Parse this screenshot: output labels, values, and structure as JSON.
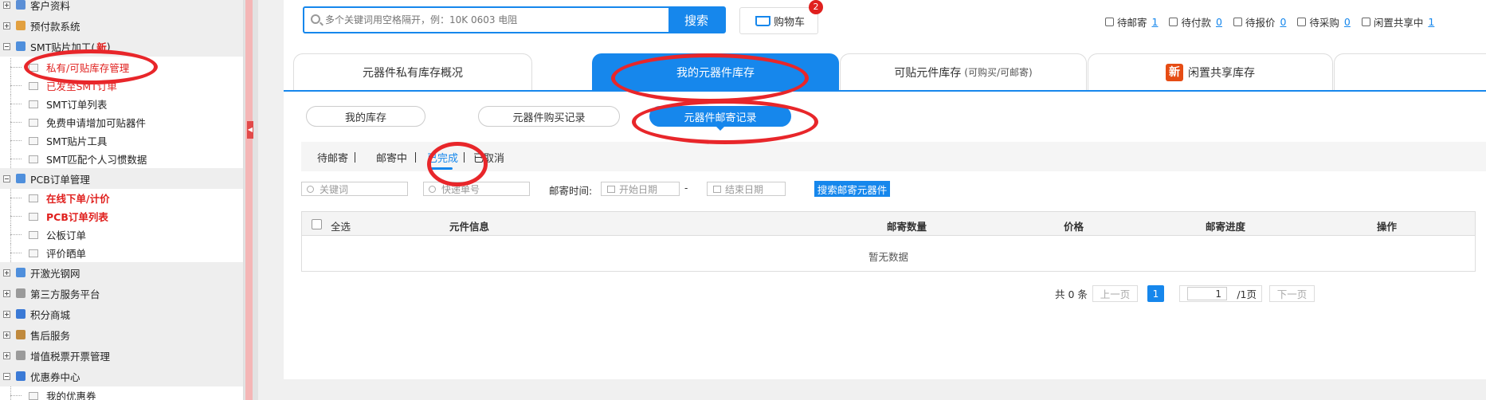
{
  "sidebar": {
    "rows": [
      {
        "kind": "group",
        "label": "客户资料",
        "expander": "plus",
        "icon_color": "#5b8fd6",
        "icon": "user-icon"
      },
      {
        "kind": "group",
        "label": "预付款系统",
        "expander": "plus",
        "icon_color": "#e2a03f",
        "icon": "wallet-icon"
      },
      {
        "kind": "group",
        "label": "SMT贴片加工(",
        "tag": "新",
        "tag_end": ")",
        "expander": "minus",
        "icon_color": "#4f8fdc",
        "icon": "chip-icon"
      },
      {
        "kind": "item",
        "label": "私有/可贴库存管理",
        "style": "red2"
      },
      {
        "kind": "item",
        "label": "已发至SMT订单",
        "style": "red2"
      },
      {
        "kind": "item",
        "label": "SMT订单列表"
      },
      {
        "kind": "item",
        "label": "免费申请增加可贴器件"
      },
      {
        "kind": "item",
        "label": "SMT贴片工具"
      },
      {
        "kind": "item",
        "label": "SMT匹配个人习惯数据"
      },
      {
        "kind": "group",
        "label": "PCB订单管理",
        "expander": "minus",
        "icon_color": "#4f8fdc",
        "icon": "board-icon"
      },
      {
        "kind": "item",
        "label": "在线下单/计价",
        "style": "red"
      },
      {
        "kind": "item",
        "label": "PCB订单列表",
        "style": "red"
      },
      {
        "kind": "item",
        "label": "公板订单"
      },
      {
        "kind": "item",
        "label": "评价晒单"
      },
      {
        "kind": "group",
        "label": "开激光钢网",
        "expander": "plus",
        "icon_color": "#4f8fdc",
        "icon": "laser-icon"
      },
      {
        "kind": "group",
        "label": "第三方服务平台",
        "expander": "plus",
        "icon_color": "#9a9a9a",
        "icon": "service-icon"
      },
      {
        "kind": "group",
        "label": "积分商城",
        "expander": "plus",
        "icon_color": "#3b7ad6",
        "icon": "coin-icon"
      },
      {
        "kind": "group",
        "label": "售后服务",
        "expander": "plus",
        "icon_color": "#c08a3e",
        "icon": "support-icon"
      },
      {
        "kind": "group",
        "label": "增值税票开票管理",
        "expander": "plus",
        "icon_color": "#9a9a9a",
        "icon": "invoice-icon"
      },
      {
        "kind": "group",
        "label": "优惠券中心",
        "expander": "minus",
        "icon_color": "#3b7ad6",
        "icon": "coupon-icon"
      },
      {
        "kind": "item",
        "label": "我的优惠券"
      }
    ],
    "collapse_arrow": "◀"
  },
  "search": {
    "placeholder": "多个关键词用空格隔开，例：10K 0603 电阻",
    "button": "搜索"
  },
  "cart": {
    "label": "购物车",
    "badge": "2"
  },
  "status": [
    {
      "label": "待邮寄",
      "count": "1"
    },
    {
      "label": "待付款",
      "count": "0"
    },
    {
      "label": "待报价",
      "count": "0"
    },
    {
      "label": "待采购",
      "count": "0"
    },
    {
      "label": "闲置共享中",
      "count": "1"
    }
  ],
  "top_tabs": [
    {
      "label": "元器件私有库存概况"
    },
    {
      "label": "我的元器件库存",
      "active": true
    },
    {
      "label": "可贴元件库存",
      "sub": "(可购买/可邮寄)"
    },
    {
      "label": "闲置共享库存",
      "badge": "新"
    }
  ],
  "sub_tabs": [
    {
      "label": "我的库存"
    },
    {
      "label": "元器件购买记录"
    },
    {
      "label": "元器件邮寄记录",
      "active": true
    }
  ],
  "status_tabs": [
    {
      "label": "待邮寄"
    },
    {
      "label": "邮寄中"
    },
    {
      "label": "已完成",
      "active": true
    },
    {
      "label": "已取消"
    }
  ],
  "filters": {
    "keyword_placeholder": "关键词",
    "tracking_placeholder": "快递单号",
    "time_label": "邮寄时间:",
    "start_placeholder": "开始日期",
    "dash": "-",
    "end_placeholder": "结束日期",
    "button": "搜索邮寄元器件"
  },
  "table": {
    "select_all": "全选",
    "columns": [
      "元件信息",
      "邮寄数量",
      "价格",
      "邮寄进度",
      "操作"
    ],
    "empty": "暂无数据"
  },
  "pagination": {
    "total": "共 0 条",
    "prev": "上一页",
    "current": "1",
    "page_input": "1",
    "page_suffix": "/1页",
    "next": "下一页"
  },
  "colors": {
    "accent": "#1687ec",
    "danger": "#e0201e",
    "annotation": "#e8262a"
  }
}
